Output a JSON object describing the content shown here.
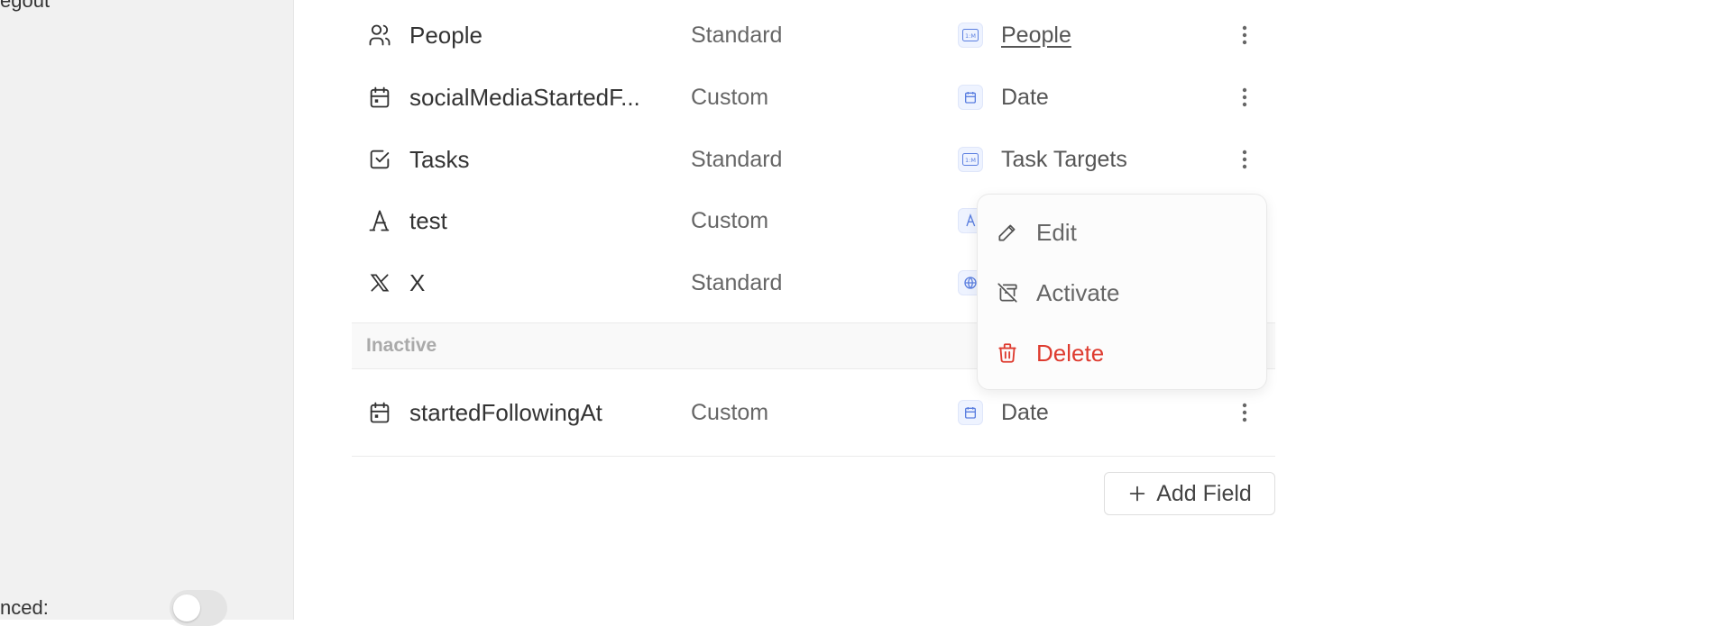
{
  "sidebar": {
    "top_label_partial": "egout",
    "advanced_label_partial": "nced:",
    "advanced_toggle_on": false
  },
  "rows": [
    {
      "name": "People",
      "icon": "users-icon",
      "type": "Standard",
      "datatype": "People",
      "datatype_icon": "relation-icon",
      "datatype_link": true
    },
    {
      "name": "socialMediaStartedF...",
      "icon": "calendar-icon",
      "type": "Custom",
      "datatype": "Date",
      "datatype_icon": "date-icon",
      "datatype_link": false
    },
    {
      "name": "Tasks",
      "icon": "checkbox-icon",
      "type": "Standard",
      "datatype": "Task Targets",
      "datatype_icon": "relation-icon",
      "datatype_link": false
    },
    {
      "name": "test",
      "icon": "text-icon",
      "type": "Custom",
      "datatype": "",
      "datatype_icon": "text-icon",
      "datatype_link": false
    },
    {
      "name": "X",
      "icon": "x-logo-icon",
      "type": "Standard",
      "datatype": "",
      "datatype_icon": "globe-icon",
      "datatype_link": false
    }
  ],
  "inactive_section": {
    "title": "Inactive",
    "rows": [
      {
        "name": "startedFollowingAt",
        "icon": "calendar-icon",
        "type": "Custom",
        "datatype": "Date",
        "datatype_icon": "date-icon"
      }
    ]
  },
  "add_field_label": "Add Field",
  "context_menu": {
    "items": [
      {
        "label": "Edit",
        "icon": "pencil-icon",
        "danger": false
      },
      {
        "label": "Activate",
        "icon": "archive-off-icon",
        "danger": false
      },
      {
        "label": "Delete",
        "icon": "trash-icon",
        "danger": true
      }
    ]
  },
  "colors": {
    "accent_chip": "#eef3ff",
    "chip_icon": "#5b7fe0",
    "danger": "#de3b2f"
  }
}
